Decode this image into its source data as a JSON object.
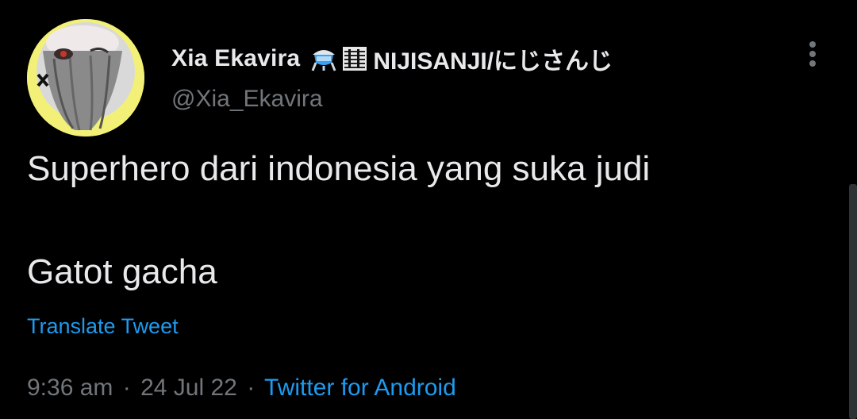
{
  "tweet": {
    "author": {
      "display_name": "Xia Ekavira",
      "name_suffix": "NIJISANJI/にじさんじ",
      "handle": "@Xia_Ekavira",
      "emoji_icons": [
        "flask-icon",
        "sheet-music-icon"
      ],
      "avatar_icon": "profile-avatar"
    },
    "text_lines": [
      "Superhero dari indonesia yang suka judi",
      "Gatot gacha"
    ],
    "translate_label": "Translate Tweet",
    "meta": {
      "time": "9:36 am",
      "separator": "·",
      "date": "24 Jul 22",
      "source": "Twitter for Android"
    },
    "more_icon": "more-vertical-icon"
  },
  "colors": {
    "background": "#000000",
    "primary_text": "#e7e9ea",
    "secondary_text": "#71767b",
    "link": "#1d9bf0",
    "avatar_bg": "#f3f078"
  }
}
